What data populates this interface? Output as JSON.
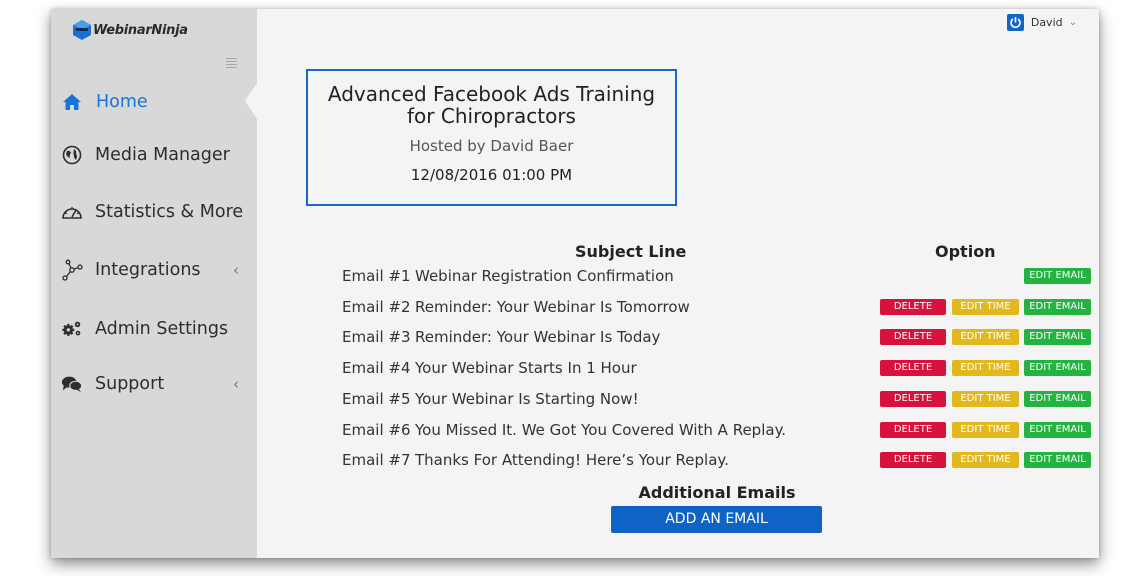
{
  "app": {
    "logo_text": "WebinarNinja"
  },
  "user": {
    "name": "David"
  },
  "sidebar": {
    "items": [
      {
        "label": "Home",
        "icon": "home-icon",
        "active": true
      },
      {
        "label": "Media Manager",
        "icon": "globe-icon"
      },
      {
        "label": "Statistics & More",
        "icon": "speedometer-icon"
      },
      {
        "label": "Integrations",
        "icon": "network-icon",
        "has_submenu": true
      },
      {
        "label": "Admin Settings",
        "icon": "gears-icon"
      },
      {
        "label": "Support",
        "icon": "chat-bubbles-icon",
        "has_submenu": true
      }
    ]
  },
  "webinar": {
    "title": "Advanced Facebook Ads Training for Chiropractors",
    "host": "Hosted by David Baer",
    "datetime": "12/08/2016 01:00 PM"
  },
  "emails": {
    "col_subject": "Subject Line",
    "col_option": "Option",
    "buttons": {
      "delete": "DELETE",
      "edit_time": "EDIT TIME",
      "edit_email": "EDIT EMAIL"
    },
    "rows": [
      {
        "num": "Email #1",
        "subject": "Webinar Registration Confirmation"
      },
      {
        "num": "Email #2",
        "subject": "Reminder: Your Webinar Is Tomorrow"
      },
      {
        "num": "Email #3",
        "subject": "Reminder: Your Webinar Is Today"
      },
      {
        "num": "Email #4",
        "subject": "Your Webinar Starts In 1 Hour"
      },
      {
        "num": "Email #5",
        "subject": "Your Webinar Is Starting Now!"
      },
      {
        "num": "Email #6",
        "subject": "You Missed It. We Got You Covered With A Replay."
      },
      {
        "num": "Email #7",
        "subject": "Thanks For Attending! Here’s Your Replay."
      }
    ]
  },
  "additional": {
    "title": "Additional Emails",
    "add_button": "ADD AN EMAIL"
  },
  "colors": {
    "accent": "#1b67c9",
    "delete": "#d9123d",
    "edit_time": "#e2b81f",
    "edit_email": "#23b341"
  }
}
